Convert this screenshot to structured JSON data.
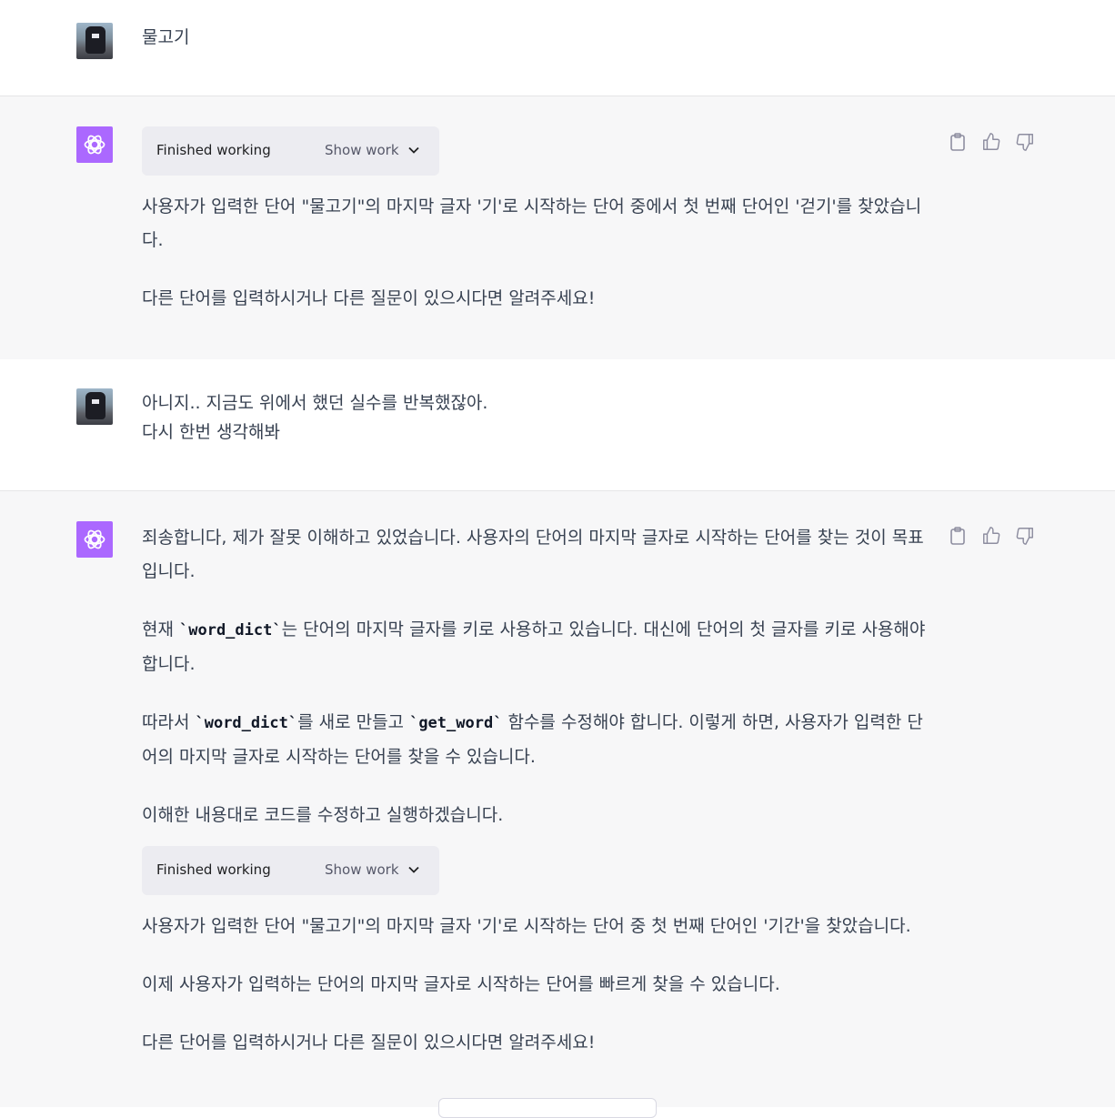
{
  "messages": [
    {
      "role": "user",
      "lines": [
        "물고기"
      ]
    },
    {
      "role": "assistant",
      "working": {
        "label": "Finished working",
        "show": "Show work"
      },
      "paragraphs": [
        "사용자가 입력한 단어 \"물고기\"의 마지막 글자 '기'로 시작하는 단어 중에서 첫 번째 단어인 '걷기'를 찾았습니다.",
        "다른 단어를 입력하시거나 다른 질문이 있으시다면 알려주세요!"
      ]
    },
    {
      "role": "user",
      "lines": [
        "아니지.. 지금도 위에서 했던 실수를 반복했잖아.",
        "다시 한번 생각해봐"
      ]
    },
    {
      "role": "assistant",
      "p1": "죄송합니다, 제가 잘못 이해하고 있었습니다. 사용자의 단어의 마지막 글자로 시작하는 단어를 찾는 것이 목표입니다.",
      "p2": {
        "before": "현재 ",
        "code": "`word_dict`",
        "after": "는 단어의 마지막 글자를 키로 사용하고 있습니다. 대신에 단어의 첫 글자를 키로 사용해야 합니다."
      },
      "p3": {
        "before": "따라서 ",
        "code1": "`word_dict`",
        "middle": "를 새로 만들고 ",
        "code2": "`get_word`",
        "after": " 함수를 수정해야 합니다. 이렇게 하면, 사용자가 입력한 단어의 마지막 글자로 시작하는 단어를 찾을 수 있습니다."
      },
      "p4": "이해한 내용대로 코드를 수정하고 실행하겠습니다.",
      "working": {
        "label": "Finished working",
        "show": "Show work"
      },
      "p5": "사용자가 입력한 단어 \"물고기\"의 마지막 글자 '기'로 시작하는 단어 중 첫 번째 단어인 '기간'을 찾았습니다.",
      "p6": "이제 사용자가 입력하는 단어의 마지막 글자로 시작하는 단어를 빠르게 찾을 수 있습니다.",
      "p7": "다른 단어를 입력하시거나 다른 질문이 있으시다면 알려주세요!"
    }
  ],
  "icons": [
    "copy-icon",
    "thumbs-up-icon",
    "thumbs-down-icon",
    "chevron-down-icon",
    "openai-logo-icon"
  ],
  "colors": {
    "assistant_avatar": "#ab68ff",
    "assistant_bg": "#f7f7f8",
    "working_bg": "#ececf1"
  }
}
